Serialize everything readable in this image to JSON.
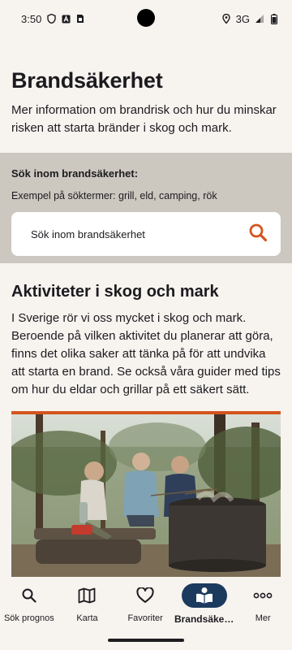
{
  "status_bar": {
    "time": "3:50",
    "network": "3G",
    "icons": [
      "shield-icon",
      "font-icon",
      "sim-icon",
      "location-icon",
      "signal-icon",
      "battery-icon"
    ]
  },
  "page": {
    "title": "Brandsäkerhet",
    "intro": "Mer information om brandrisk och hur du minskar risken att starta bränder i skog och mark."
  },
  "search": {
    "title": "Sök inom brandsäkerhet:",
    "examples": "Exempel på söktermer:  grill, eld, camping, rök",
    "placeholder": "Sök inom brandsäkerhet"
  },
  "section": {
    "heading": "Aktiviteter i skog och mark",
    "body": "I Sverige rör vi oss mycket i skog och mark. Beroende på vilken aktivitet du planerar att göra, finns det olika saker att tänka på för att undvika att starta en brand. Se också våra guider med tips om hur du eldar och grillar på ett säkert sätt."
  },
  "bottom_nav": {
    "items": [
      {
        "label": "Sök prognos",
        "icon": "search-icon"
      },
      {
        "label": "Karta",
        "icon": "map-icon"
      },
      {
        "label": "Favoriter",
        "icon": "heart-icon"
      },
      {
        "label": "Brandsäke…",
        "icon": "book-reader-icon",
        "active": true
      },
      {
        "label": "Mer",
        "icon": "more-icon"
      }
    ]
  },
  "colors": {
    "background": "#f7f3ef",
    "search_panel": "#ccc7bf",
    "accent": "#d4541e",
    "nav_active": "#1c3a5e"
  }
}
